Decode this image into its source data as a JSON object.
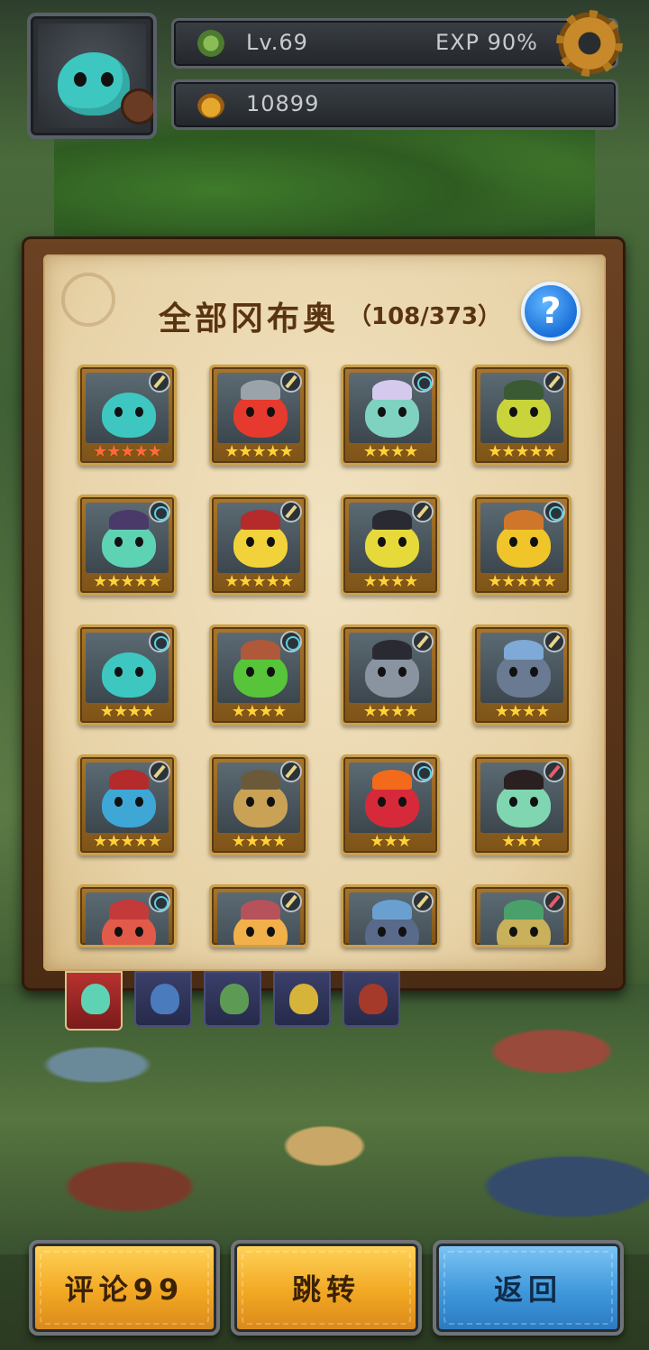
{
  "hud": {
    "level": "Lv.69",
    "exp": "EXP 90%",
    "currency": "10899"
  },
  "panel": {
    "title": "全部冈布奥",
    "count": "（108/373）",
    "help": "?"
  },
  "cards": [
    {
      "stars": "★★★★★",
      "stars_count": 5,
      "badge": "blade",
      "color": "#3dc7c0",
      "hat": "",
      "red_stars": true
    },
    {
      "stars": "★★★★★",
      "stars_count": 5,
      "badge": "blade",
      "color": "#e53a2d",
      "hat": "#9aa3aa"
    },
    {
      "stars": "★★★★",
      "stars_count": 4,
      "badge": "swirl",
      "color": "#7fd1c0",
      "hat": "#d6c9ee"
    },
    {
      "stars": "★★★★★",
      "stars_count": 5,
      "badge": "blade",
      "color": "#c8d43a",
      "hat": "#3a5a33"
    },
    {
      "stars": "★★★★★",
      "stars_count": 5,
      "badge": "swirl",
      "color": "#5ed3b3",
      "hat": "#4a3a6a"
    },
    {
      "stars": "★★★★★",
      "stars_count": 5,
      "badge": "blade",
      "color": "#f2d23a",
      "hat": "#b52a2a"
    },
    {
      "stars": "★★★★",
      "stars_count": 4,
      "badge": "blade",
      "color": "#e6da3a",
      "hat": "#2a2a33"
    },
    {
      "stars": "★★★★★",
      "stars_count": 5,
      "badge": "swirl",
      "color": "#f0c52a",
      "hat": "#d0762a"
    },
    {
      "stars": "★★★★",
      "stars_count": 4,
      "badge": "swirl",
      "color": "#3dc7c0",
      "hat": ""
    },
    {
      "stars": "★★★★",
      "stars_count": 4,
      "badge": "swirl",
      "color": "#58c43a",
      "hat": "#b0583a"
    },
    {
      "stars": "★★★★",
      "stars_count": 4,
      "badge": "blade",
      "color": "#8a93a0",
      "hat": "#2a2a33"
    },
    {
      "stars": "★★★★",
      "stars_count": 4,
      "badge": "blade",
      "color": "#6a7a92",
      "hat": "#7fa9d6"
    },
    {
      "stars": "★★★★★",
      "stars_count": 5,
      "badge": "blade",
      "color": "#3fa7d6",
      "hat": "#b52a2a"
    },
    {
      "stars": "★★★★",
      "stars_count": 4,
      "badge": "blade",
      "color": "#c9a255",
      "hat": "#6a5a3a"
    },
    {
      "stars": "★★★",
      "stars_count": 3,
      "badge": "swirl",
      "color": "#d62a3a",
      "hat": "#f26a1a"
    },
    {
      "stars": "★★★",
      "stars_count": 3,
      "badge": "wand",
      "color": "#7fd6b0",
      "hat": "#2a2020"
    },
    {
      "stars": "",
      "stars_count": 0,
      "badge": "swirl",
      "color": "#e25a4a",
      "hat": "#c43a3a"
    },
    {
      "stars": "",
      "stars_count": 0,
      "badge": "blade",
      "color": "#f2b04a",
      "hat": "#b5525a"
    },
    {
      "stars": "",
      "stars_count": 0,
      "badge": "blade",
      "color": "#5a6a8a",
      "hat": "#6aa0d0"
    },
    {
      "stars": "",
      "stars_count": 0,
      "badge": "wand",
      "color": "#c9b05a",
      "hat": "#4aa06a"
    }
  ],
  "categories": [
    {
      "name": "all",
      "active": true,
      "color": "#5ed3b3"
    },
    {
      "name": "tab-2",
      "active": false,
      "color": "#4a7bbd"
    },
    {
      "name": "tab-3",
      "active": false,
      "color": "#5d9b55"
    },
    {
      "name": "tab-4",
      "active": false,
      "color": "#d6b43a"
    },
    {
      "name": "tab-5",
      "active": false,
      "color": "#a53a2a"
    }
  ],
  "buttons": {
    "comments": "评论99",
    "jump": "跳转",
    "back": "返回"
  },
  "colors": {
    "accent_yellow": "#f2a823",
    "accent_blue": "#3f98db",
    "title_brown": "#5a3411",
    "star": "#ffd23a"
  }
}
